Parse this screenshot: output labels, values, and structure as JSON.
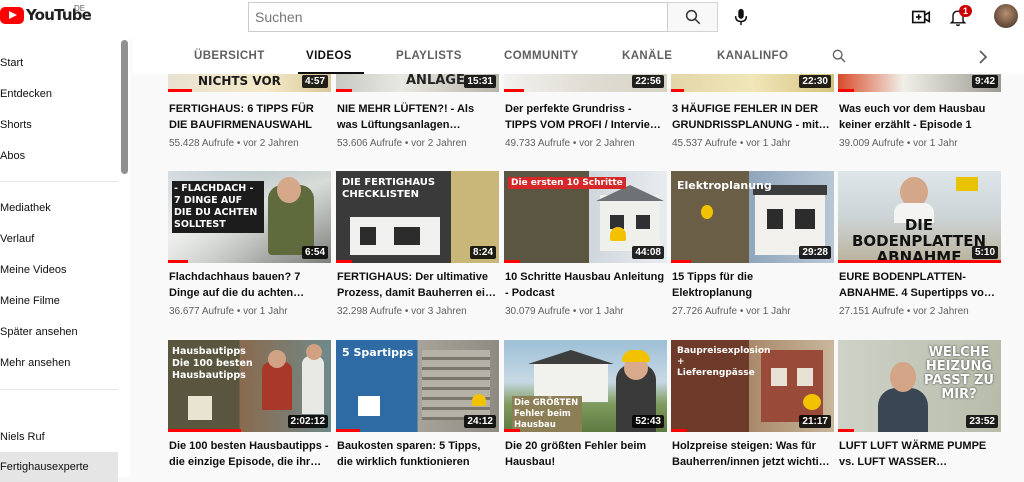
{
  "header": {
    "logo_text": "YouTube",
    "logo_country": "DE",
    "search_placeholder": "Suchen",
    "notification_count": "1",
    "icons": [
      "youtube-logo-icon",
      "search-icon",
      "microphone-icon",
      "create-video-icon",
      "bell-icon",
      "avatar"
    ]
  },
  "sidebar": {
    "items": [
      {
        "label": "Start"
      },
      {
        "label": "Entdecken"
      },
      {
        "label": "Shorts"
      },
      {
        "label": "Abos"
      },
      {
        "label": "Mediathek"
      },
      {
        "label": "Verlauf"
      },
      {
        "label": "Meine Videos"
      },
      {
        "label": "Meine Filme"
      },
      {
        "label": "Später ansehen"
      },
      {
        "label": "Mehr ansehen"
      },
      {
        "label": "Niels Ruf"
      },
      {
        "label": "Fertighausexperte"
      }
    ]
  },
  "tabs": [
    {
      "label": "ÜBERSICHT"
    },
    {
      "label": "VIDEOS"
    },
    {
      "label": "PLAYLISTS"
    },
    {
      "label": "COMMUNITY"
    },
    {
      "label": "KANÄLE"
    },
    {
      "label": "KANALINFO"
    }
  ],
  "videos": [
    {
      "title": "FERTIGHAUS: 6 TIPPS FÜR DIE BAUFIRMENAUSWAHL",
      "views": "55.428 Aufrufe",
      "age": "vor 2 Jahren",
      "duration": "4:57",
      "thumb_text": "NICHTS VOR",
      "progress": 0.15
    },
    {
      "title": "NIE MEHR LÜFTEN?! - Als was Lüftungsanlagen…",
      "views": "53.606 Aufrufe",
      "age": "vor 2 Jahren",
      "duration": "15:31",
      "thumb_text": "ANLAGE",
      "progress": 0.1
    },
    {
      "title": "Der perfekte Grundriss - TIPPS VOM PROFI / Intervie…",
      "views": "49.733 Aufrufe",
      "age": "vor 2 Jahren",
      "duration": "22:56",
      "thumb_text": "",
      "progress": 0.12
    },
    {
      "title": "3 HÄUFIGE FEHLER IN DER GRUNDRISSPLANUNG - mit…",
      "views": "45.537 Aufrufe",
      "age": "vor 1 Jahr",
      "duration": "22:30",
      "thumb_text": "",
      "progress": 0.08
    },
    {
      "title": "Was euch vor dem Hausbau keiner erzählt - Episode 1",
      "views": "39.009 Aufrufe",
      "age": "vor 1 Jahr",
      "duration": "9:42",
      "thumb_text": "",
      "progress": 0.1
    },
    {
      "title": "Flachdachhaus bauen? 7 Dinge auf die du achten…",
      "views": "36.677 Aufrufe",
      "age": "vor 1 Jahr",
      "duration": "6:54",
      "thumb_text": "- FLACHDACH - 7 DINGE AUF DIE DU ACHTEN SOLLTEST",
      "progress": 0.12
    },
    {
      "title": "FERTIGHAUS: Der ultimative Prozess, damit Bauherren ei…",
      "views": "32.298 Aufrufe",
      "age": "vor 3 Jahren",
      "duration": "8:24",
      "thumb_text": "DIE FERTIGHAUS CHECKLISTEN",
      "progress": 0.1
    },
    {
      "title": "10 Schritte Hausbau Anleitung - Podcast",
      "views": "30.079 Aufrufe",
      "age": "vor 1 Jahr",
      "duration": "44:08",
      "thumb_text": "Die ersten 10 Schritte",
      "progress": 0.1
    },
    {
      "title": "15 Tipps für die Elektroplanung",
      "views": "27.726 Aufrufe",
      "age": "vor 1 Jahr",
      "duration": "29:28",
      "thumb_text": "Elektroplanung",
      "progress": 0.12
    },
    {
      "title": "EURE BODENPLATTEN-ABNAHME. 4 Supertipps vo…",
      "views": "27.151 Aufrufe",
      "age": "vor 2 Jahren",
      "duration": "5:10",
      "thumb_text": "DIE BODENPLATTEN ABNAHME",
      "progress": 1.0
    },
    {
      "title": "Die 100 besten Hausbautipps - die einzige Episode, die ihr…",
      "views": "",
      "age": "",
      "duration": "2:02:12",
      "thumb_text": "Hausbautipps Die 100 besten Hausbautipps",
      "progress": 0.45
    },
    {
      "title": "Baukosten sparen: 5 Tipps, die wirklich funktionieren",
      "views": "",
      "age": "",
      "duration": "24:12",
      "thumb_text": "5 Spartipps",
      "progress": 0.15
    },
    {
      "title": "Die 20 größten Fehler beim Hausbau!",
      "views": "",
      "age": "",
      "duration": "52:43",
      "thumb_text": "Die GRÖßTEN Fehler beim Hausbau",
      "progress": 0.1
    },
    {
      "title": "Holzpreise steigen: Was für Bauherren/innen jetzt wichti…",
      "views": "",
      "age": "",
      "duration": "21:17",
      "thumb_text": "Baupreisexplosion + Lieferengpässe",
      "progress": 0.1
    },
    {
      "title": "LUFT LUFT WÄRME PUMPE vs. LUFT WASSER…",
      "views": "",
      "age": "",
      "duration": "23:52",
      "thumb_text": "WELCHE HEIZUNG PASST ZU MIR?",
      "progress": 0.1
    }
  ]
}
